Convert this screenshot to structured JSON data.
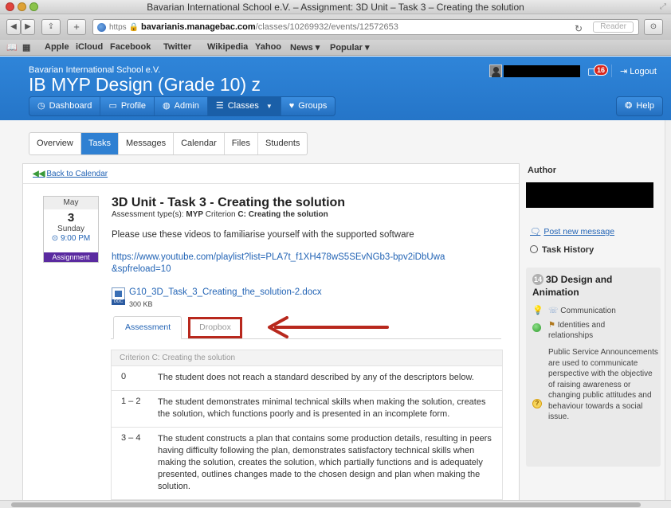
{
  "window": {
    "title": "Bavarian International School e.V. – Assignment: 3D Unit – Task 3 – Creating the solution"
  },
  "browser": {
    "url_scheme": "https",
    "url_host": "bavarianis.managebac.com",
    "url_path": "/classes/10269932/events/12572653",
    "reader_label": "Reader",
    "bookmarks": [
      "Apple",
      "iCloud",
      "Facebook",
      "Twitter",
      "Wikipedia",
      "Yahoo",
      "News ▾",
      "Popular ▾"
    ]
  },
  "header": {
    "school": "Bavarian International School e.V.",
    "class_title": "IB MYP Design (Grade 10) z",
    "notifications": "16",
    "logout": "Logout",
    "help": "Help",
    "nav": [
      {
        "label": "Dashboard",
        "icon": "dashboard-icon"
      },
      {
        "label": "Profile",
        "icon": "profile-card-icon"
      },
      {
        "label": "Admin",
        "icon": "globe-icon"
      },
      {
        "label": "Classes",
        "icon": "list-icon"
      },
      {
        "label": "Groups",
        "icon": "heart-icon"
      }
    ]
  },
  "tabs": [
    "Overview",
    "Tasks",
    "Messages",
    "Calendar",
    "Files",
    "Students"
  ],
  "active_tab": "Tasks",
  "task": {
    "back_link": "Back to Calendar",
    "date": {
      "month": "May",
      "day": "3",
      "weekday": "Sunday",
      "time": "9:00 PM",
      "type": "Assignment"
    },
    "title": "3D Unit - Task 3 - Creating the solution",
    "assessment_type_prefix": "Assessment type(s): ",
    "assessment_type_myp": "MYP",
    "assessment_type_criterion": " Criterion ",
    "assessment_type_name": "C: Creating the solution",
    "description": "Please use these videos to familiarise yourself with the supported software",
    "link": "https://www.youtube.com/playlist?list=PLA7t_f1XH478wS5SEvNGb3-bpv2iDbUwa&spfreload=10",
    "attachment": {
      "name": "G10_3D_Task_3_Creating_the_solution-2.docx",
      "size": "300 KB",
      "badge": "DOC"
    },
    "sub_tabs": [
      "Assessment",
      "Dropbox"
    ],
    "criteria": {
      "heading": "Criterion C: Creating the solution",
      "rows": [
        {
          "score": "0",
          "text": "The student does not reach a standard described by any of the descriptors below."
        },
        {
          "score": "1 – 2",
          "text": "The student demonstrates minimal technical skills when making the solution, creates the solution, which functions poorly and is presented in an incomplete form."
        },
        {
          "score": "3 – 4",
          "text": "The student constructs a plan that contains some production details, resulting in peers having difficulty following the plan, demonstrates satisfactory technical skills when making the solution, creates the solution, which partially functions and is adequately presented, outlines changes made to the chosen design and plan when making the solution."
        }
      ]
    }
  },
  "sidebar": {
    "author_label": "Author",
    "post_message": "Post new message",
    "task_history": "Task History",
    "unit": {
      "count": "14",
      "title": "3D Design and Animation",
      "key_concept": "Communication",
      "global_context": "Identities and relationships",
      "statement": "Public Service Announcements are used to communicate perspective with the objective of raising awareness or changing public attitudes and behaviour towards a social issue."
    }
  },
  "colors": {
    "header_blue": "#2a7dd0",
    "assignment_purple": "#5a2aa0",
    "annotation_red": "#b8281d",
    "link_blue": "#2364b5"
  }
}
